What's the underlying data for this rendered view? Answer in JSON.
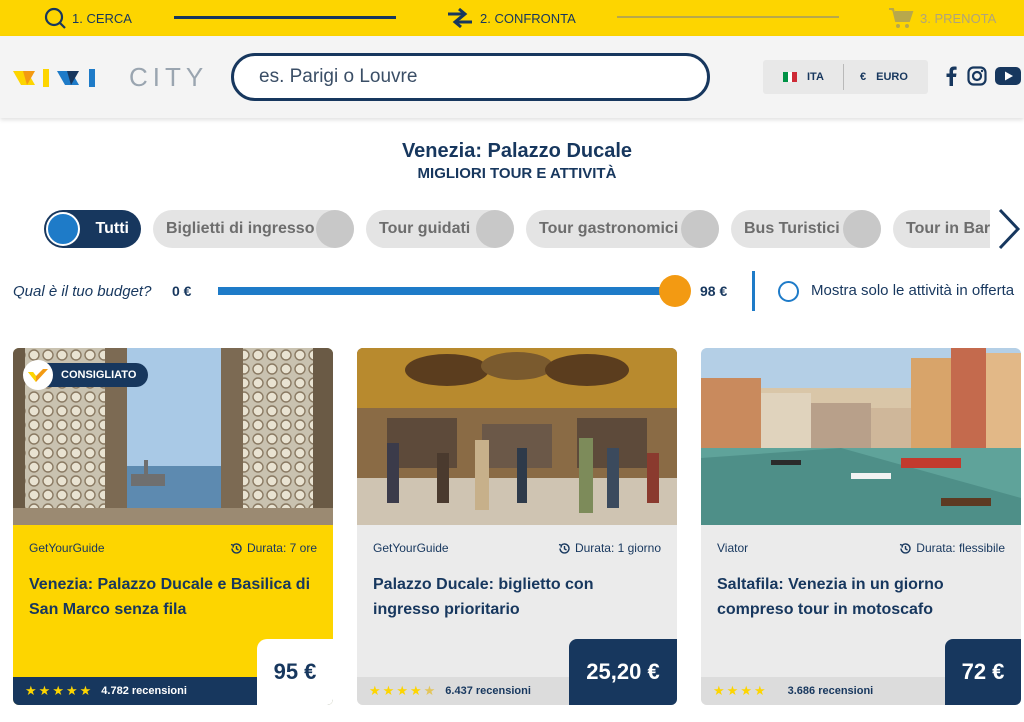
{
  "steps": [
    {
      "label": "1. CERCA",
      "icon": "search-icon"
    },
    {
      "label": "2. CONFRONTA",
      "icon": "compare-arrows-icon"
    },
    {
      "label": "3. PRENOTA",
      "icon": "cart-icon"
    }
  ],
  "header": {
    "logo_text": "CITY",
    "search_placeholder": "es. Parigi o Louvre",
    "language": "ITA",
    "currency_symbol": "€",
    "currency": "EURO",
    "social": [
      "facebook-icon",
      "instagram-icon",
      "youtube-icon"
    ]
  },
  "page": {
    "title": "Venezia: Palazzo Ducale",
    "subtitle": "MIGLIORI TOUR E ATTIVITÀ"
  },
  "categories": [
    {
      "label": "Tutti",
      "active": true
    },
    {
      "label": "Biglietti di ingresso",
      "active": false
    },
    {
      "label": "Tour guidati",
      "active": false
    },
    {
      "label": "Tour gastronomici",
      "active": false
    },
    {
      "label": "Bus Turistici",
      "active": false
    },
    {
      "label": "Tour in Barca",
      "active": false
    }
  ],
  "budget": {
    "question": "Qual è il tuo budget?",
    "min_label": "0 €",
    "max_label": "98 €",
    "slider_fraction": 1.0,
    "offers_label": "Mostra solo le attività in offerta"
  },
  "cards": [
    {
      "badge": "CONSIGLIATO",
      "provider": "GetYourGuide",
      "duration": "Durata: 7 ore",
      "title": "Venezia: Palazzo Ducale e Basilica di San Marco senza fila",
      "rating": 5,
      "reviews": "4.782 recensioni",
      "price": "95 €"
    },
    {
      "provider": "GetYourGuide",
      "duration": "Durata: 1 giorno",
      "title": "Palazzo Ducale: biglietto con ingresso prioritario",
      "rating": 4.5,
      "reviews": "6.437 recensioni",
      "price": "25,20 €"
    },
    {
      "provider": "Viator",
      "duration": "Durata: flessibile",
      "title": "Saltafila: Venezia in un giorno compreso tour in motoscafo",
      "rating": 4,
      "reviews": "3.686 recensioni",
      "price": "72 €"
    }
  ],
  "colors": {
    "brand_yellow": "#fdd500",
    "navy": "#17375e",
    "blue": "#1e7bc8",
    "orange": "#f39a12"
  }
}
